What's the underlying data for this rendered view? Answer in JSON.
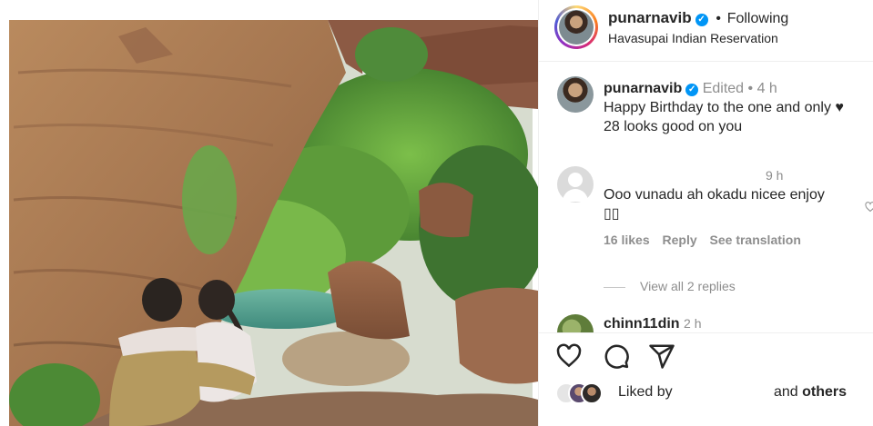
{
  "post": {
    "username": "punarnavib",
    "separator": "•",
    "follow_status": "Following",
    "location": "Havasupai Indian Reservation"
  },
  "caption": {
    "username": "punarnavib",
    "edited": "Edited",
    "dot": "•",
    "time": "4 h",
    "line1": "Happy Birthday to the one and only",
    "heart": "♥",
    "line2": "28 looks good on you"
  },
  "comment1": {
    "time": "9 h",
    "text_line1": "Ooo vunadu ah okadu nicee enjoy",
    "text_line2": "▯▯",
    "likes": "16 likes",
    "reply": "Reply",
    "see_translation": "See translation"
  },
  "view_replies": "View all 2 replies",
  "comment2": {
    "username": "chinn11din",
    "time": "2 h"
  },
  "footer": {
    "liked_by": "Liked by",
    "and": "and",
    "others": "others"
  },
  "icons": {
    "verified": "verified-badge-icon",
    "like": "heart-icon",
    "comment": "comment-bubble-icon",
    "share": "paper-plane-icon",
    "comment_like": "small-heart-icon"
  },
  "colors": {
    "verified": "#0095f6",
    "muted": "#8e8e8e",
    "text": "#262626"
  }
}
